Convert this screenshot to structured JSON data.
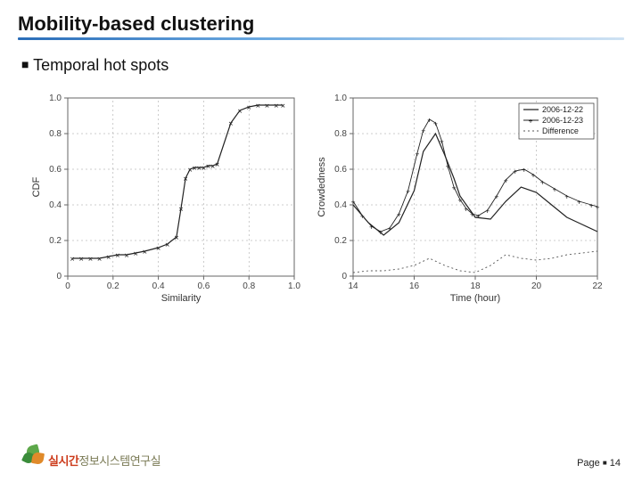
{
  "slide": {
    "title": "Mobility-based clustering",
    "subtitle": "Temporal hot spots",
    "page_label": "Page",
    "page_number": "14",
    "logo_text_accent": "실시간",
    "logo_text_rest": "정보시스템연구실"
  },
  "chart_data": [
    {
      "type": "line",
      "title": "",
      "xlabel": "Similarity",
      "ylabel": "CDF",
      "xlim": [
        0,
        1.0
      ],
      "ylim": [
        0,
        1.0
      ],
      "xticks": [
        0,
        0.2,
        0.4,
        0.6,
        0.8,
        1.0
      ],
      "yticks": [
        0,
        0.2,
        0.4,
        0.6,
        0.8,
        1.0
      ],
      "series": [
        {
          "name": "CDF",
          "marker": "x",
          "x": [
            0.02,
            0.06,
            0.1,
            0.14,
            0.18,
            0.22,
            0.26,
            0.3,
            0.34,
            0.4,
            0.44,
            0.48,
            0.5,
            0.52,
            0.54,
            0.56,
            0.58,
            0.6,
            0.62,
            0.64,
            0.66,
            0.72,
            0.76,
            0.8,
            0.84,
            0.88,
            0.92,
            0.95
          ],
          "y": [
            0.1,
            0.1,
            0.1,
            0.1,
            0.11,
            0.12,
            0.12,
            0.13,
            0.14,
            0.16,
            0.18,
            0.22,
            0.38,
            0.55,
            0.6,
            0.61,
            0.61,
            0.61,
            0.62,
            0.62,
            0.63,
            0.86,
            0.93,
            0.95,
            0.96,
            0.96,
            0.96,
            0.96
          ]
        }
      ]
    },
    {
      "type": "line",
      "title": "",
      "xlabel": "Time (hour)",
      "ylabel": "Crowdedness",
      "xlim": [
        14,
        22
      ],
      "ylim": [
        0,
        1.0
      ],
      "xticks": [
        14,
        16,
        18,
        20,
        22
      ],
      "yticks": [
        0,
        0.2,
        0.4,
        0.6,
        0.8,
        1.0
      ],
      "legend_position": "upper right",
      "series": [
        {
          "name": "2006-12-22",
          "marker": "-",
          "x": [
            14.0,
            14.5,
            15.0,
            15.5,
            16.0,
            16.3,
            16.7,
            17.0,
            17.3,
            17.5,
            18.0,
            18.5,
            19.0,
            19.5,
            20.0,
            20.5,
            21.0,
            21.5,
            22.0
          ],
          "y": [
            0.4,
            0.3,
            0.23,
            0.3,
            0.48,
            0.7,
            0.8,
            0.68,
            0.55,
            0.45,
            0.33,
            0.32,
            0.42,
            0.5,
            0.47,
            0.4,
            0.33,
            0.29,
            0.25
          ]
        },
        {
          "name": "2006-12-23",
          "marker": "+",
          "x": [
            14.0,
            14.3,
            14.6,
            14.9,
            15.2,
            15.5,
            15.8,
            16.1,
            16.3,
            16.5,
            16.7,
            16.9,
            17.1,
            17.3,
            17.5,
            17.7,
            17.9,
            18.1,
            18.4,
            18.7,
            19.0,
            19.3,
            19.6,
            19.9,
            20.2,
            20.6,
            21.0,
            21.4,
            21.8,
            22.0
          ],
          "y": [
            0.42,
            0.34,
            0.28,
            0.25,
            0.27,
            0.35,
            0.48,
            0.69,
            0.82,
            0.88,
            0.86,
            0.76,
            0.62,
            0.5,
            0.43,
            0.38,
            0.35,
            0.34,
            0.37,
            0.45,
            0.54,
            0.59,
            0.6,
            0.57,
            0.53,
            0.49,
            0.45,
            0.42,
            0.4,
            0.39
          ]
        },
        {
          "name": "Difference",
          "marker": "dotted",
          "x": [
            14.0,
            14.5,
            15.0,
            15.5,
            16.0,
            16.5,
            17.0,
            17.5,
            18.0,
            18.5,
            19.0,
            19.5,
            20.0,
            20.5,
            21.0,
            21.5,
            22.0
          ],
          "y": [
            0.02,
            0.03,
            0.03,
            0.04,
            0.06,
            0.1,
            0.06,
            0.03,
            0.02,
            0.06,
            0.12,
            0.1,
            0.09,
            0.1,
            0.12,
            0.13,
            0.14
          ]
        }
      ]
    }
  ]
}
